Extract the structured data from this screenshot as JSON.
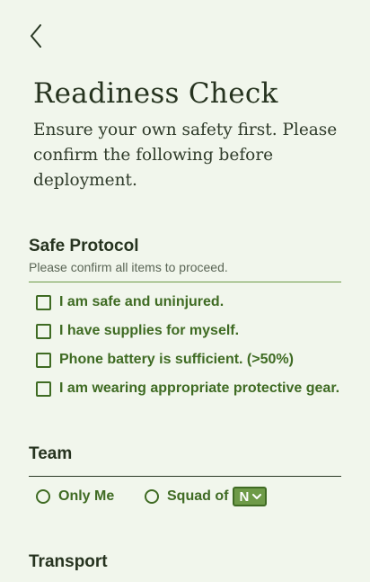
{
  "header": {
    "back_icon": "chevron-left-icon",
    "title": "Readiness Check",
    "subtitle": "Ensure your own safety first. Please confirm the following before deployment."
  },
  "safe_protocol": {
    "title": "Safe Protocol",
    "hint": "Please confirm all items to proceed.",
    "items": [
      {
        "label": "I am safe and uninjured.",
        "checked": false
      },
      {
        "label": "I have supplies for myself.",
        "checked": false
      },
      {
        "label": "Phone battery is sufficient. (>50%)",
        "checked": false
      },
      {
        "label": "I am wearing appropriate protective gear.",
        "checked": false
      }
    ]
  },
  "team": {
    "title": "Team",
    "options": [
      {
        "label": "Only Me",
        "selected": false
      },
      {
        "label": "Squad of",
        "selected": false
      }
    ],
    "squad_select_value": "N"
  },
  "transport": {
    "title": "Transport"
  },
  "colors": {
    "background": "#f1f6ec",
    "accent": "#3f6b23",
    "select_fill": "#6e9a48"
  }
}
